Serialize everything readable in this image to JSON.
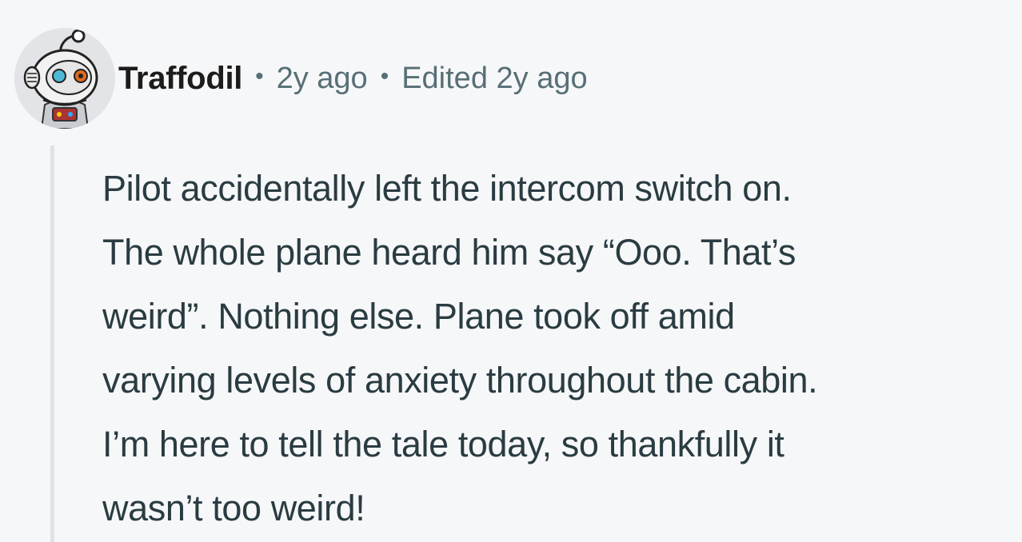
{
  "comment": {
    "author": "Traffodil",
    "separator": "•",
    "posted": "2y ago",
    "edited": "Edited 2y ago",
    "avatar_icon": "snoo-astronaut-avatar",
    "body_lines": [
      "Pilot accidentally left the intercom switch on.",
      "The whole plane heard him say “Ooo. That’s",
      "weird”. Nothing else. Plane took off amid",
      "varying levels of anxiety throughout the cabin.",
      "I’m here to tell the tale today, so thankfully it",
      "wasn’t too weird!"
    ]
  },
  "colors": {
    "background": "#f6f7f8",
    "meta_text": "#576f76",
    "body_text": "#2a3c42",
    "thread_line": "#dfe3e7"
  }
}
